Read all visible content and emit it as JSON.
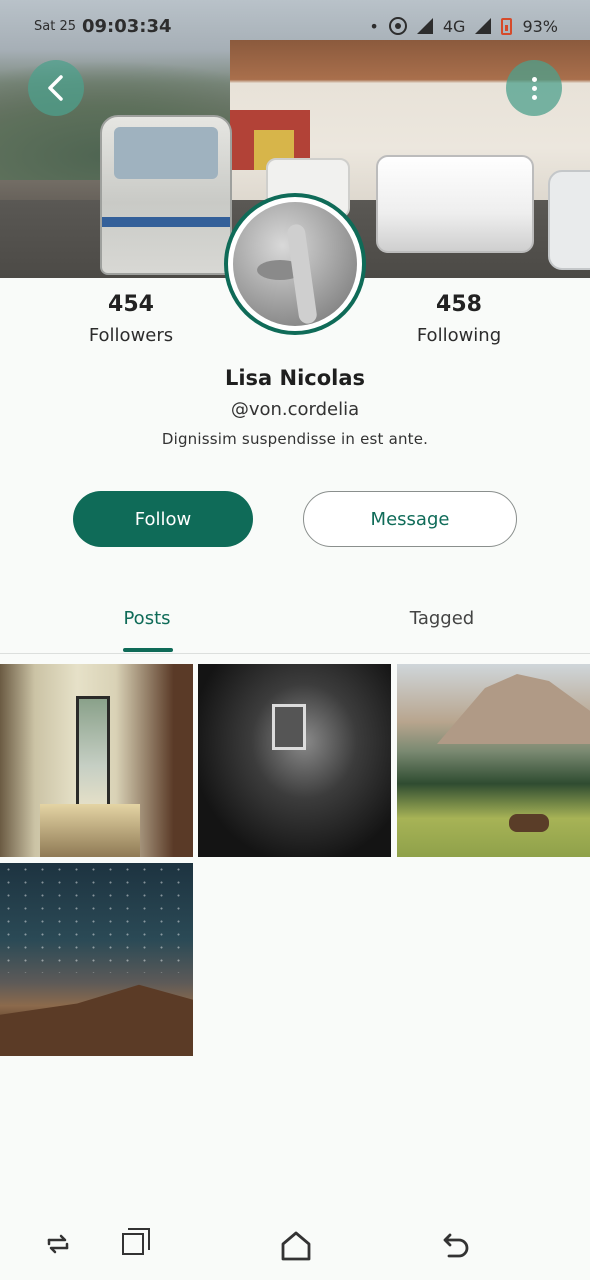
{
  "status_bar": {
    "day": "Sat 25",
    "time": "09:03:34",
    "network": "4G",
    "battery": "93%"
  },
  "header": {
    "back_icon": "chevron-left-icon",
    "more_icon": "more-vertical-icon"
  },
  "profile": {
    "name": "Lisa Nicolas",
    "handle": "@von.cordelia",
    "bio": "Dignissim suspendisse in est ante.",
    "followers_count": "454",
    "followers_label": "Followers",
    "following_count": "458",
    "following_label": "Following"
  },
  "actions": {
    "follow_label": "Follow",
    "message_label": "Message"
  },
  "tabs": [
    {
      "label": "Posts",
      "active": true
    },
    {
      "label": "Tagged",
      "active": false
    }
  ],
  "posts": [
    {
      "subject": "hallway-open-door"
    },
    {
      "subject": "dark-lantern-wall"
    },
    {
      "subject": "mountain-meadow-deer"
    },
    {
      "subject": "starry-night-dune"
    }
  ],
  "nav_bar": {
    "icons": [
      "rotate-icon",
      "recent-apps-icon",
      "home-icon",
      "back-icon"
    ]
  },
  "colors": {
    "accent": "#0f6b58",
    "background": "#f9fbf9"
  }
}
